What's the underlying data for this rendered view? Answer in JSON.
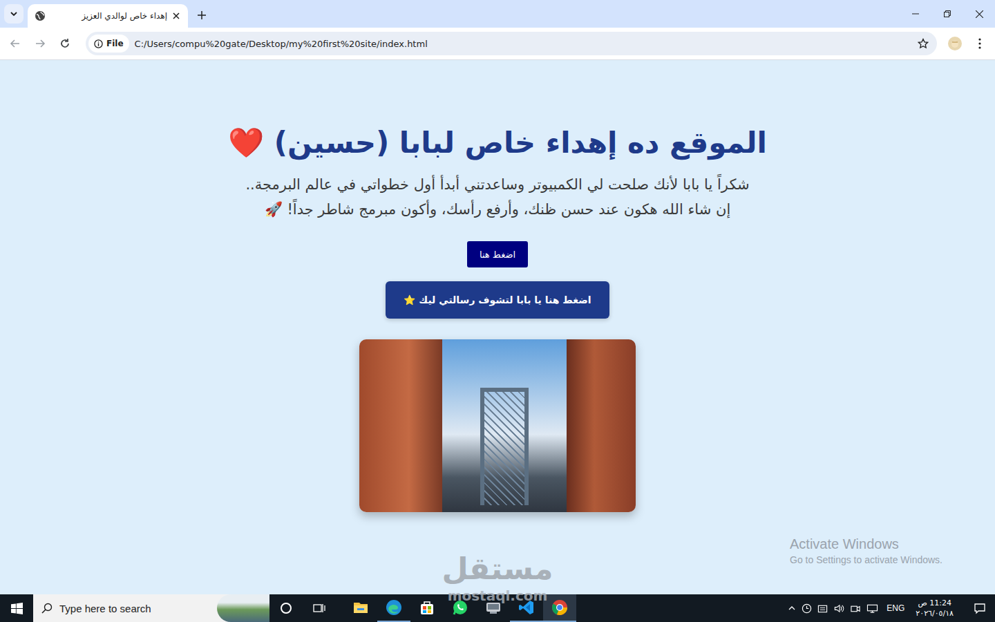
{
  "window": {
    "tab": {
      "title": "إهداء خاص لوالدي العزيز",
      "selected": true
    }
  },
  "toolbar": {
    "scheme": "File",
    "url": "C:/Users/compu%20gate/Desktop/my%20first%20site/index.html"
  },
  "page": {
    "heading": "الموقع ده إهداء خاص لبابا (حسين) ❤️",
    "lines": [
      "شكراً يا بابا لأنك صلحت لي الكمبيوتر وساعدتني أبدأ أول خطواتي في عالم البرمجة..",
      "إن شاء الله هكون عند حسن ظنك، وأرفع رأسك، وأكون مبرمج شاطر جداً! 🚀"
    ],
    "buttons": [
      {
        "label": "اضغط هنا",
        "kind": "small"
      },
      {
        "label": "اضغط هنا يا بابا لتشوف رسالتي ليك ⭐",
        "kind": "large"
      }
    ]
  },
  "watermarks": {
    "activate_title": "Activate Windows",
    "activate_sub": "Go to Settings to activate Windows.",
    "brand": "مستقل",
    "brand_url": "mostaql.com"
  },
  "taskbar": {
    "search_placeholder": "Type here to search",
    "apps": [
      {
        "kind": "explorer",
        "running": false,
        "selected": false
      },
      {
        "kind": "edge",
        "running": true,
        "selected": false
      },
      {
        "kind": "store",
        "running": false,
        "selected": false
      },
      {
        "kind": "whatsapp",
        "running": false,
        "selected": false
      },
      {
        "kind": "disk",
        "running": false,
        "selected": false
      },
      {
        "kind": "vscode",
        "running": true,
        "selected": false
      },
      {
        "kind": "chrome",
        "running": true,
        "selected": true
      }
    ],
    "language": "ENG",
    "time": "11:24 ص",
    "date": "٢٠٢٦/٠٥/١٨"
  }
}
